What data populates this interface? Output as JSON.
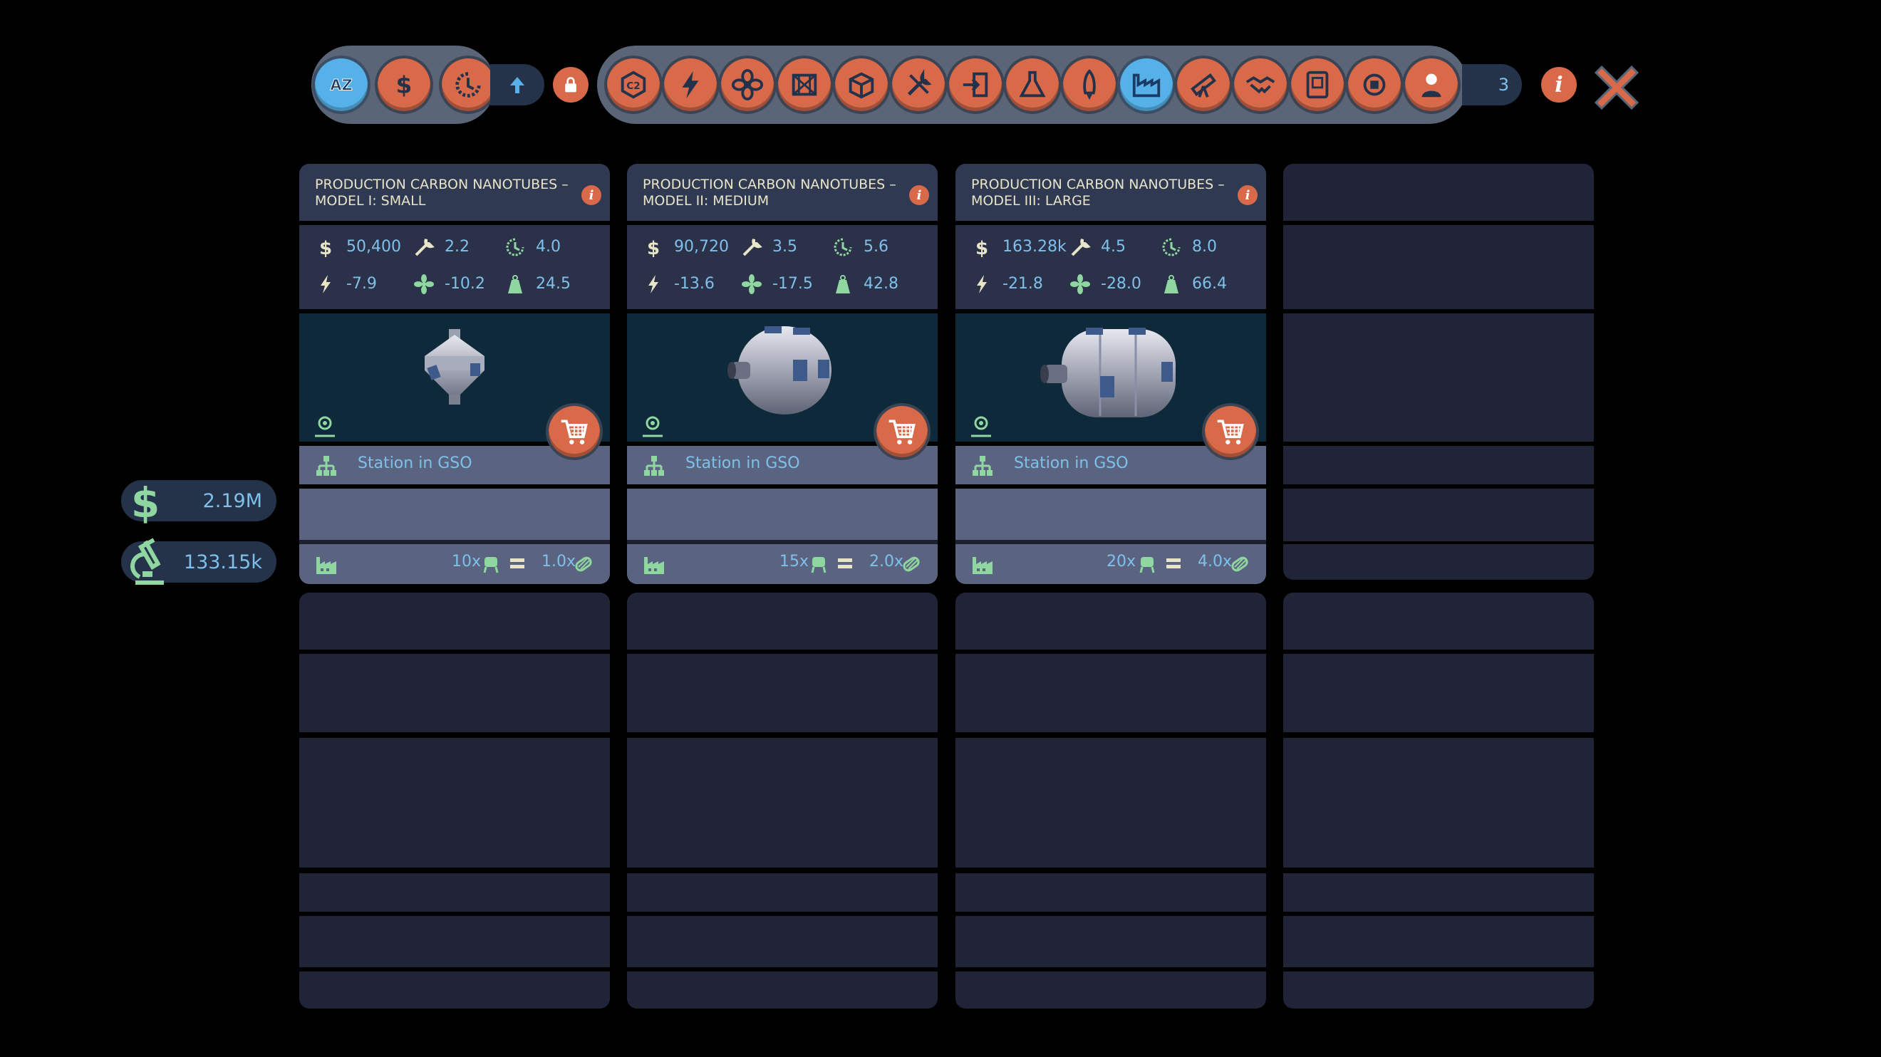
{
  "toolbar": {
    "sort_buttons": [
      {
        "name": "sort-az",
        "label": "AZ",
        "active": true
      },
      {
        "name": "sort-cost",
        "icon": "dollar-icon"
      },
      {
        "name": "sort-time",
        "icon": "clock-icon"
      }
    ],
    "category_count": "3",
    "categories": [
      "co2-icon",
      "power-icon",
      "fan-icon",
      "structure-icon",
      "cargo-icon",
      "tools-icon",
      "docking-icon",
      "chemistry-icon",
      "rocket-icon",
      "factory-icon",
      "telescope-icon",
      "handshake-icon",
      "book-icon",
      "hardware-icon",
      "astronaut-icon"
    ],
    "active_category": "factory-icon",
    "info_label": "i"
  },
  "currencies": {
    "money": "2.19M",
    "research": "133.15k"
  },
  "cards": [
    {
      "title": "PRODUCTION CARBON NANOTUBES – MODEL I: SMALL",
      "cost": "50,400",
      "maintenance": "2.2",
      "build_time": "4.0",
      "power": "-7.9",
      "air": "-10.2",
      "mass": "24.5",
      "location": "Station in GSO",
      "crew": "10x",
      "output": "1.0x"
    },
    {
      "title": "PRODUCTION CARBON NANOTUBES – MODEL II: MEDIUM",
      "cost": "90,720",
      "maintenance": "3.5",
      "build_time": "5.6",
      "power": "-13.6",
      "air": "-17.5",
      "mass": "42.8",
      "location": "Station in GSO",
      "crew": "15x",
      "output": "2.0x"
    },
    {
      "title": "PRODUCTION CARBON NANOTUBES – MODEL III: LARGE",
      "cost": "163.28k",
      "maintenance": "4.5",
      "build_time": "8.0",
      "power": "-21.8",
      "air": "-28.0",
      "mass": "66.4",
      "location": "Station in GSO",
      "crew": "20x",
      "output": "4.0x"
    }
  ],
  "colors": {
    "accent_orange": "#d86a4a",
    "accent_blue": "#56b1e8",
    "text_blue": "#7fc0ea",
    "icon_green": "#8fd6a0",
    "panel": "#202436"
  }
}
